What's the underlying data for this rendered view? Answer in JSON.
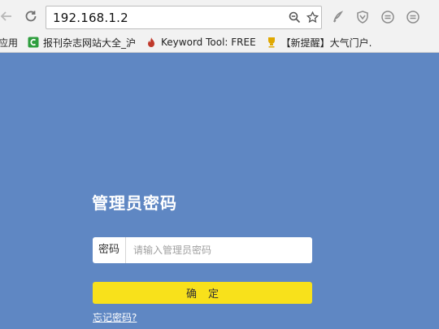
{
  "browser": {
    "url": "192.168.1.2",
    "bookmarks": [
      {
        "label": "应用",
        "icon": "apps-icon"
      },
      {
        "label": "报刊杂志网站大全_沪",
        "icon": "green-c-icon",
        "color": "#2e9e3e"
      },
      {
        "label": "Keyword Tool: FREE",
        "icon": "flame-icon",
        "color": "#c0392b"
      },
      {
        "label": "【新提醒】大气门户.",
        "icon": "trophy-icon",
        "color": "#e0a800"
      }
    ]
  },
  "login": {
    "title": "管理员密码",
    "password_label": "密码",
    "password_placeholder": "请输入管理员密码",
    "confirm_label": "确定",
    "forgot_link": "忘记密码?"
  },
  "colors": {
    "background": "#5f87c3",
    "button": "#f8e11b"
  }
}
